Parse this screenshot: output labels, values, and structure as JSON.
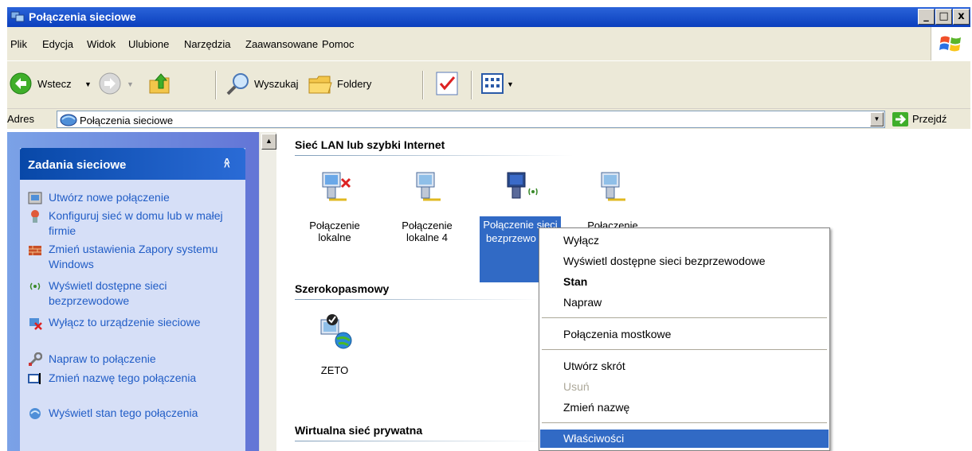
{
  "window": {
    "title": "Połączenia sieciowe",
    "buttons": [
      "_",
      "□",
      "x"
    ]
  },
  "menubar": {
    "items": [
      "Plik",
      "Edycja",
      "Widok",
      "Ulubione",
      "Narzędzia",
      "Zaawansowane",
      "Pomoc"
    ]
  },
  "toolbar": {
    "back_label": "Wstecz",
    "search_label": "Wyszukaj",
    "folders_label": "Foldery"
  },
  "addressbar": {
    "label": "Adres",
    "value": "Połączenia sieciowe",
    "go_label": "Przejdź"
  },
  "taskpane": {
    "title": "Zadania sieciowe",
    "tasks": [
      "Utwórz nowe połączenie",
      "Konfiguruj sieć w domu lub w małej firmie",
      "Zmień ustawienia Zapory systemu Windows",
      "Wyświetl dostępne sieci bezprzewodowe",
      "Wyłącz to urządzenie sieciowe",
      "Napraw to połączenie",
      "Zmień nazwę tego połączenia",
      "Wyświetl stan tego połączenia"
    ]
  },
  "groups": {
    "lan": "Sieć LAN lub szybki Internet",
    "broadband": "Szerokopasmowy",
    "vpn": "Wirtualna sieć prywatna"
  },
  "connections": {
    "local": "Połączenie lokalne",
    "local4": "Połączenie lokalne 4",
    "wireless": "Połączenie sieci bezprzewo wej",
    "partial": "Połaczenie",
    "zeto": "ZETO"
  },
  "context_menu": {
    "items": [
      "Wyłącz",
      "Wyświetl dostępne sieci bezprzewodowe",
      "Stan",
      "Napraw",
      "Połączenia mostkowe",
      "Utwórz skrót",
      "Usuń",
      "Zmień nazwę",
      "Właściwości"
    ]
  },
  "colors": {
    "title_bar": "#0b3fbd",
    "selection": "#316ac5",
    "task_link": "#215dc6"
  }
}
